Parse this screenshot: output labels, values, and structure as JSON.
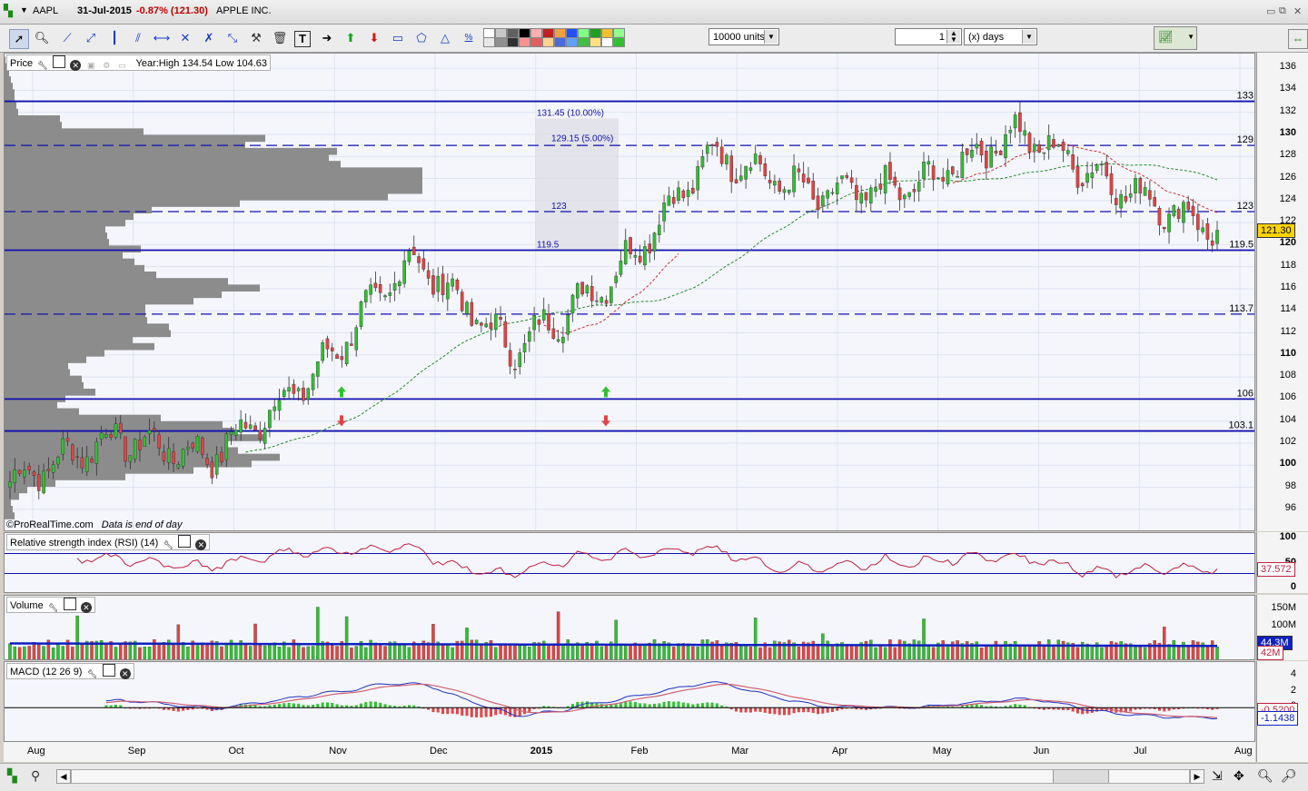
{
  "titlebar": {
    "symbol": "AAPL",
    "date": "31-Jul-2015",
    "change": "-0.87% (121.30)",
    "name": "APPLE INC."
  },
  "toolbar": {
    "units": "10000 units",
    "period_value": "1",
    "period_unit": "(x) days"
  },
  "price_panel": {
    "label": "Price",
    "year_range": "Year:High 134.54 Low 104.63",
    "copyright": "©ProRealTime.com",
    "data_note": "Data is end of day",
    "last_price": "121.30",
    "y_ticks": [
      "136",
      "134",
      "132",
      "130",
      "128",
      "126",
      "124",
      "122",
      "120",
      "118",
      "116",
      "114",
      "112",
      "110",
      "108",
      "106",
      "104",
      "102",
      "100",
      "98",
      "96"
    ],
    "bold_ticks": [
      "130",
      "120",
      "110",
      "100"
    ],
    "level_labels": [
      {
        "text": "133",
        "v": 133
      },
      {
        "text": "129",
        "v": 129
      },
      {
        "text": "123",
        "v": 123
      },
      {
        "text": "119.5",
        "v": 119.5
      },
      {
        "text": "113.7",
        "v": 113.7
      },
      {
        "text": "106",
        "v": 106
      },
      {
        "text": "103.1",
        "v": 103.1
      }
    ],
    "fib_labels": [
      {
        "text": "131.45 (10.00%)",
        "v": 131.45
      },
      {
        "text": "129.15 (5.00%)",
        "v": 129.15
      },
      {
        "text": "123",
        "v": 123
      },
      {
        "text": "119.5",
        "v": 119.5
      }
    ]
  },
  "rsi_panel": {
    "label": "Relative strength index (RSI) (14)",
    "y_ticks": [
      "100",
      "50",
      "0"
    ],
    "last": "37.572"
  },
  "volume_panel": {
    "label": "Volume",
    "y_ticks": [
      "150M",
      "100M"
    ],
    "avg": "44.3M",
    "last": "42M"
  },
  "macd_panel": {
    "label": "MACD (12 26 9)",
    "y_ticks": [
      "4",
      "2",
      "0",
      "-2"
    ],
    "signal": "-0.5200",
    "value": "-1.1438"
  },
  "x_axis": [
    {
      "text": "Aug",
      "bold": false
    },
    {
      "text": "Sep",
      "bold": false
    },
    {
      "text": "Oct",
      "bold": false
    },
    {
      "text": "Nov",
      "bold": false
    },
    {
      "text": "Dec",
      "bold": false
    },
    {
      "text": "2015",
      "bold": true
    },
    {
      "text": "Feb",
      "bold": false
    },
    {
      "text": "Mar",
      "bold": false
    },
    {
      "text": "Apr",
      "bold": false
    },
    {
      "text": "May",
      "bold": false
    },
    {
      "text": "Jun",
      "bold": false
    },
    {
      "text": "Jul",
      "bold": false
    },
    {
      "text": "Aug",
      "bold": false
    }
  ],
  "chart_data": {
    "type": "candlestick",
    "title": "AAPL",
    "ylim": [
      94.5,
      137
    ],
    "monthly_closes": [
      {
        "m": "Aug",
        "c": 102.5
      },
      {
        "m": "Sep",
        "c": 100.8
      },
      {
        "m": "Oct",
        "c": 108.0
      },
      {
        "m": "Nov",
        "c": 118.9
      },
      {
        "m": "Dec",
        "c": 110.4
      },
      {
        "m": "Jan",
        "c": 117.2
      },
      {
        "m": "Feb",
        "c": 128.5
      },
      {
        "m": "Mar",
        "c": 124.4
      },
      {
        "m": "Apr",
        "c": 125.2
      },
      {
        "m": "May",
        "c": 130.3
      },
      {
        "m": "Jun",
        "c": 125.4
      },
      {
        "m": "Jul",
        "c": 121.3
      }
    ],
    "horizontal_levels": [
      133,
      129,
      123,
      119.5,
      113.7,
      106,
      103.1
    ]
  },
  "colors": {
    "up": "#2ec22e",
    "down": "#e04545",
    "level": "#1010b0",
    "profile": "#8c8c8c",
    "ma": "#2a8a2a",
    "ma2": "#d03030"
  }
}
